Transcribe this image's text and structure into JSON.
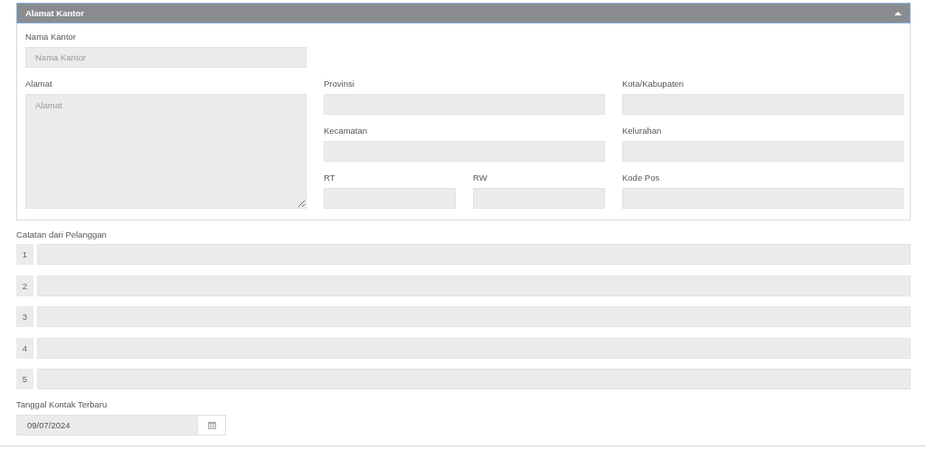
{
  "panel": {
    "title": "Alamat Kantor",
    "expanded": true,
    "fields": [
      {
        "label": "Nama Kantor",
        "placeholder": "Nama Kantor",
        "kind": "text"
      },
      {
        "label": "Alamat",
        "placeholder": "Alamat",
        "kind": "textarea"
      },
      {
        "label": "Provinsi",
        "kind": "text"
      },
      {
        "label": "Kota/Kabupaten",
        "kind": "text"
      },
      {
        "label": "Kecamatan",
        "kind": "text"
      },
      {
        "label": "Kelurahan",
        "kind": "text"
      },
      {
        "label": "RT",
        "kind": "text"
      },
      {
        "label": "RW",
        "kind": "text"
      },
      {
        "label": "Kode Pos",
        "kind": "text"
      }
    ]
  },
  "notes": {
    "label": "Catatan dari Pelanggan",
    "lines": [
      {
        "number": "1"
      },
      {
        "number": "2"
      },
      {
        "number": "3"
      },
      {
        "number": "4"
      },
      {
        "number": "5"
      }
    ]
  },
  "last_contact": {
    "label": "Tanggal Kontak Terbaru",
    "value": "09/07/2024"
  }
}
